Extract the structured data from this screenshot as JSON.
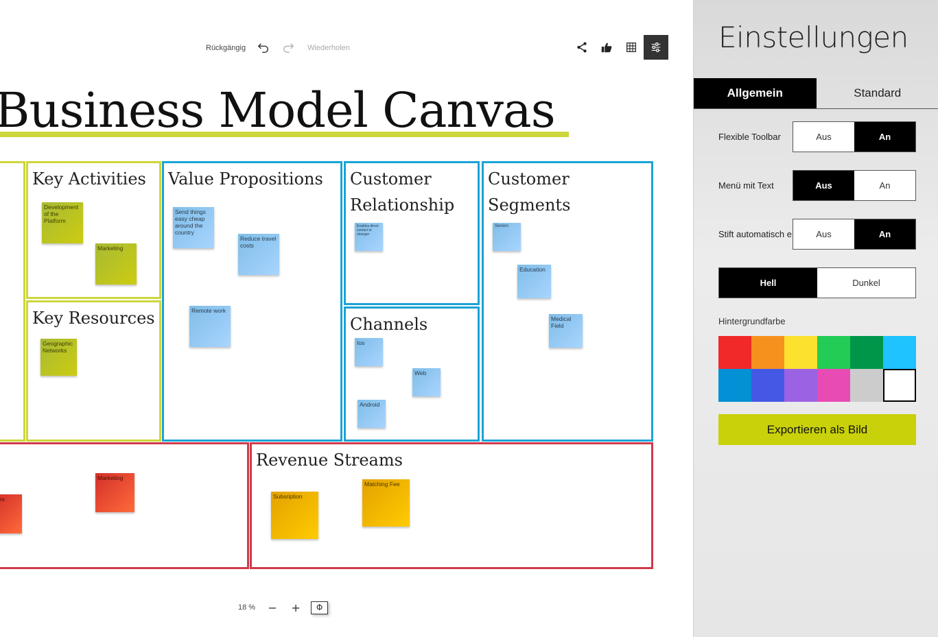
{
  "toolbar": {
    "undo_label": "Rückgängig",
    "redo_label": "Wiederholen",
    "undo_icon": "undo-icon",
    "redo_icon": "redo-icon",
    "share_icon": "share-icon",
    "like_icon": "thumbs-up-icon",
    "grid_icon": "grid-icon",
    "settings_icon": "sliders-icon"
  },
  "board": {
    "title": "Business Model Canvas",
    "title_color": "#cdd63a",
    "boxes": {
      "key_activities": "Key Activities",
      "key_resources": "Key Resources",
      "value_propositions": "Value Propositions",
      "customer_relationship": "Customer Relationship",
      "channels": "Channels",
      "customer_segments": "Customer Segments",
      "revenue_streams": "Revenue Streams"
    },
    "notes": {
      "development": "Development of the Platform",
      "marketing_green": "Marketing",
      "geographic": "Geographic Networks",
      "send_things": "Send things easy cheap around the country",
      "reduce_travel": "Reduce travel costs",
      "remote_work": "Remote work",
      "enables": "Enables direct contact to stranger",
      "ios": "Ios",
      "web": "Web",
      "android": "Android",
      "seniors": "Seniors",
      "education": "Education",
      "medical": "Medical Field",
      "marketing_red": "Marketing",
      "partial_red": "ies",
      "subscription": "Subsription",
      "matching_fee": "Matching Fee"
    }
  },
  "zoom": {
    "value": "18 %",
    "minus": "−",
    "plus": "+",
    "fit": "Φ"
  },
  "settings": {
    "title": "Einstellungen",
    "tabs": [
      "Allgemein",
      "Standard"
    ],
    "active_tab": "Allgemein",
    "rows": [
      {
        "label": "Flexible Toolbar",
        "off": "Aus",
        "on": "An",
        "selected": "An"
      },
      {
        "label": "Menü mit Text",
        "off": "Aus",
        "on": "An",
        "selected": "Aus"
      },
      {
        "label": "Stift automatisch e",
        "off": "Aus",
        "on": "An",
        "selected": "An"
      }
    ],
    "theme": {
      "light": "Hell",
      "dark": "Dunkel",
      "selected": "Hell"
    },
    "background_label": "Hintergrundfarbe",
    "background_colors": [
      "#f12929",
      "#f7911d",
      "#fde12f",
      "#22cc55",
      "#00964a",
      "#1ec3ff",
      "#0390d4",
      "#4458e5",
      "#9b62e3",
      "#e94bb4",
      "#cccccc",
      "#ffffff"
    ],
    "background_selected": "#ffffff",
    "export_label": "Exportieren als Bild",
    "export_color": "#c9d10a"
  }
}
